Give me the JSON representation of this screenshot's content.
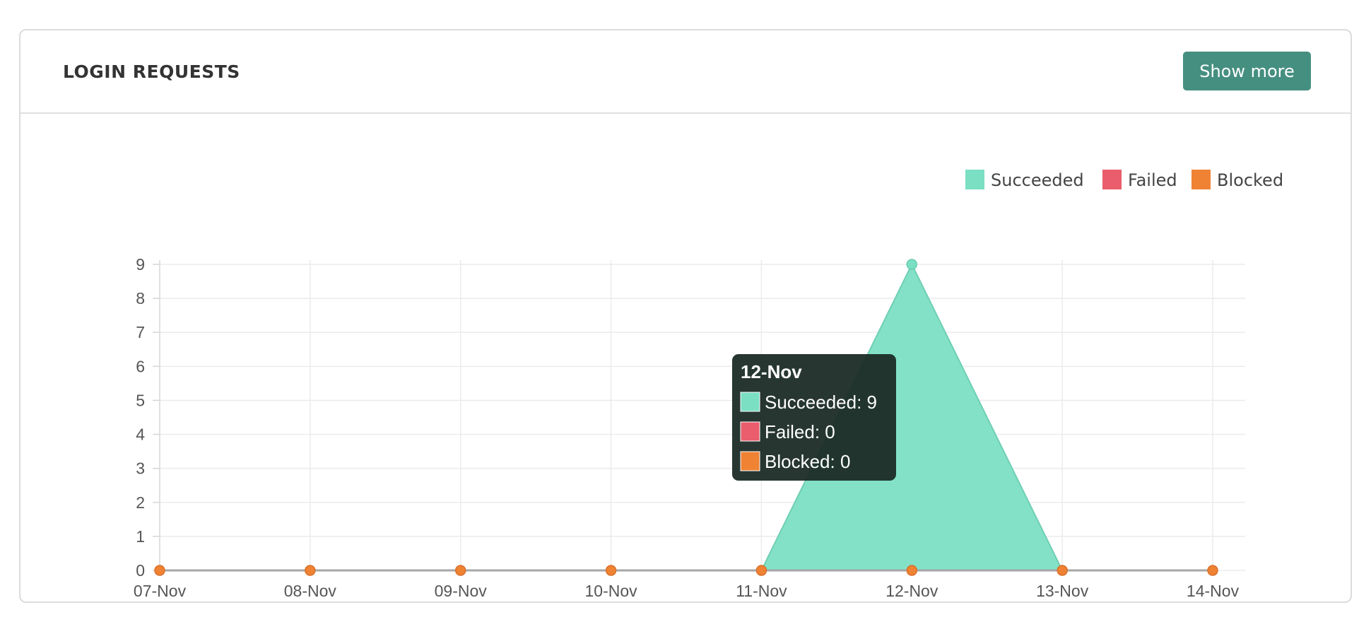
{
  "card": {
    "title": "LOGIN REQUESTS",
    "show_more_label": "Show more"
  },
  "colors": {
    "succeeded": "#7bdfc3",
    "failed": "#e95d6c",
    "blocked": "#ef8233",
    "button": "#458f81",
    "tooltip_bg": "#1b2b26"
  },
  "chart_data": {
    "type": "area",
    "categories": [
      "07-Nov",
      "08-Nov",
      "09-Nov",
      "10-Nov",
      "11-Nov",
      "12-Nov",
      "13-Nov",
      "14-Nov"
    ],
    "series": [
      {
        "name": "Succeeded",
        "values": [
          0,
          0,
          0,
          0,
          0,
          9,
          0,
          0
        ]
      },
      {
        "name": "Failed",
        "values": [
          0,
          0,
          0,
          0,
          0,
          0,
          0,
          0
        ]
      },
      {
        "name": "Blocked",
        "values": [
          0,
          0,
          0,
          0,
          0,
          0,
          0,
          0
        ]
      }
    ],
    "ylim": [
      0,
      9
    ],
    "yticks": [
      0,
      1,
      2,
      3,
      4,
      5,
      6,
      7,
      8,
      9
    ],
    "grid": true,
    "legend_position": "top-right",
    "tooltip": {
      "title": "12-Nov",
      "lines": [
        "Succeeded: 9",
        "Failed: 0",
        "Blocked: 0"
      ]
    }
  }
}
